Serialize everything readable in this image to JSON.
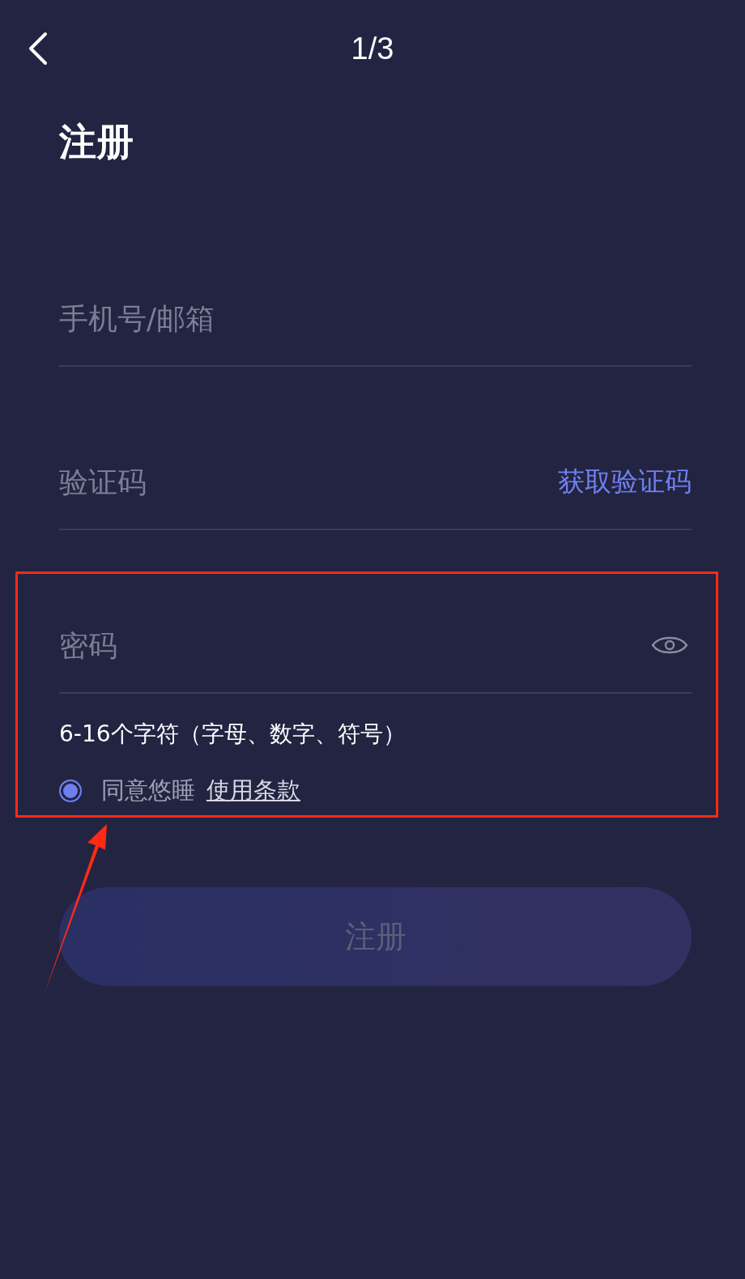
{
  "header": {
    "step": "1/3"
  },
  "title": "注册",
  "fields": [
    {
      "kind": "text",
      "placeholder": "手机号/邮箱"
    },
    {
      "kind": "code",
      "placeholder": "验证码",
      "action": "获取验证码"
    },
    {
      "kind": "password",
      "placeholder": "密码"
    }
  ],
  "password_hint": "6-16个字符（字母、数字、符号）",
  "agreement": {
    "checked": true,
    "text": "同意悠睡",
    "link": "使用条款"
  },
  "submit": {
    "label": "注册",
    "disabled": true
  }
}
